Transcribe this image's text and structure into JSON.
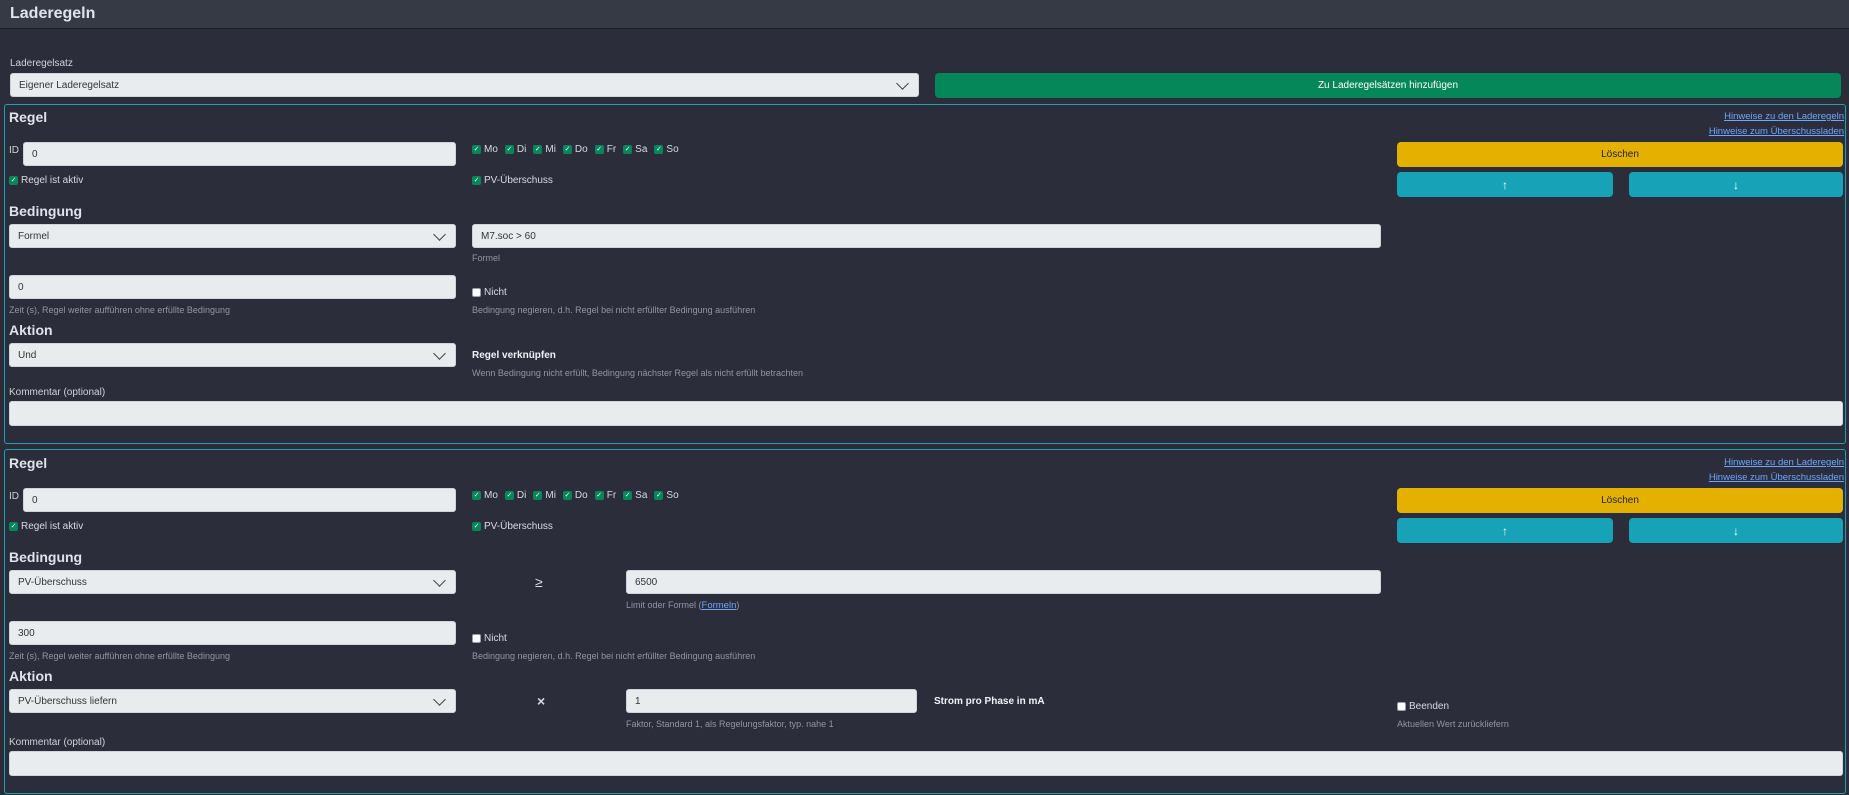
{
  "header": {
    "title": "Laderegeln"
  },
  "ruleset": {
    "label": "Laderegelsatz",
    "selected": "Eigener Laderegelsatz",
    "add_button": "Zu Laderegelsätzen hinzufügen"
  },
  "colors": {
    "accent": "#17a2b8",
    "success": "#06875a",
    "warning": "#e4b100",
    "link": "#6ea7ff"
  },
  "common": {
    "regel": "Regel",
    "id_label": "ID",
    "active_label": "Regel ist aktiv",
    "pv_label": "PV-Überschuss",
    "delete": "Löschen",
    "up_icon": "↑",
    "down_icon": "↓",
    "hint1": "Hinweise zu den Laderegeln",
    "hint2": "Hinweise zum Überschussladen",
    "bedingung": "Bedingung",
    "aktion": "Aktion",
    "zeit_help": "Zeit (s), Regel weiter aufführen ohne erfüllte Bedingung",
    "nicht": "Nicht",
    "nicht_help": "Bedingung negieren, d.h. Regel bei nicht erfüllter Bedingung ausführen",
    "kommentar": "Kommentar (optional)",
    "days": [
      "Mo",
      "Di",
      "Mi",
      "Do",
      "Fr",
      "Sa",
      "So"
    ]
  },
  "rule1": {
    "id": "0",
    "condition_type": "Formel",
    "formula": "M7.soc > 60",
    "formula_label": "Formel",
    "time": "0",
    "action": "Und",
    "link_title": "Regel verknüpfen",
    "link_help": "Wenn Bedingung nicht erfüllt, Bedingung nächster Regel als nicht erfüllt betrachten",
    "comment": ""
  },
  "rule2": {
    "id": "0",
    "condition_type": "PV-Überschuss",
    "operator": "≥",
    "limit": "6500",
    "limit_help": "Limit oder Formel (",
    "limit_link": "Formeln",
    "limit_help_end": ")",
    "time": "300",
    "action": "PV-Überschuss liefern",
    "multiply": "×",
    "factor": "1",
    "factor_help": "Faktor, Standard 1, als Regelungsfaktor, typ. nahe 1",
    "strom_label": "Strom pro Phase in mA",
    "beenden": "Beenden",
    "beenden_help": "Aktuellen Wert zurückliefern",
    "comment": ""
  }
}
